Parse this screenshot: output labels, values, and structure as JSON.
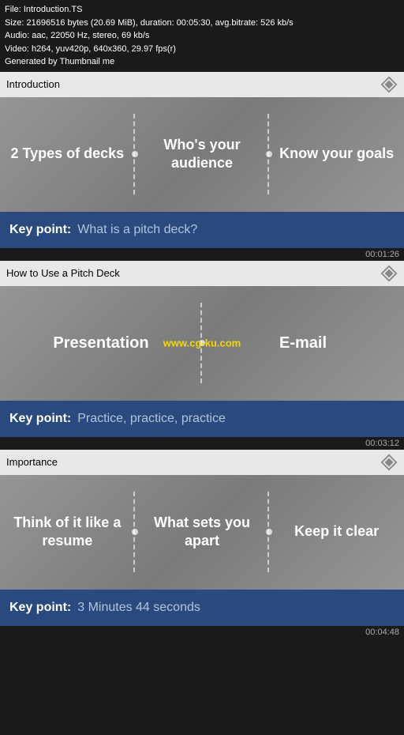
{
  "file_info": {
    "line1": "File: Introduction.TS",
    "line2": "Size: 21696516 bytes (20.69 MiB), duration: 00:05:30, avg.bitrate: 526 kb/s",
    "line3": "Audio: aac, 22050 Hz, stereo, 69 kb/s",
    "line4": "Video: h264, yuv420p, 640x360, 29.97 fps(r)",
    "line5": "Generated by Thumbnail me"
  },
  "sections": [
    {
      "id": "introduction",
      "label": "Introduction",
      "cells": [
        {
          "text": "2 Types of decks"
        },
        {
          "text": "Who's your audience"
        },
        {
          "text": "Know your goals"
        }
      ],
      "key_point": {
        "label": "Key point:",
        "text": "What is a pitch deck?"
      },
      "timestamp": "00:01:26"
    },
    {
      "id": "how-to-use",
      "label": "How to Use a Pitch Deck",
      "cells": [
        {
          "text": "Presentation"
        },
        {
          "text": "E-mail"
        }
      ],
      "watermark": "www.cg-ku.com",
      "key_point": {
        "label": "Key point:",
        "text": "Practice, practice, practice"
      },
      "timestamp": "00:03:12"
    },
    {
      "id": "importance",
      "label": "Importance",
      "cells": [
        {
          "text": "Think of it like a resume"
        },
        {
          "text": "What sets you apart"
        },
        {
          "text": "Keep it clear"
        }
      ],
      "key_point": {
        "label": "Key point:",
        "text": "3 Minutes 44 seconds"
      },
      "timestamp": "00:04:48"
    }
  ],
  "icons": {
    "diamond": "◈"
  }
}
